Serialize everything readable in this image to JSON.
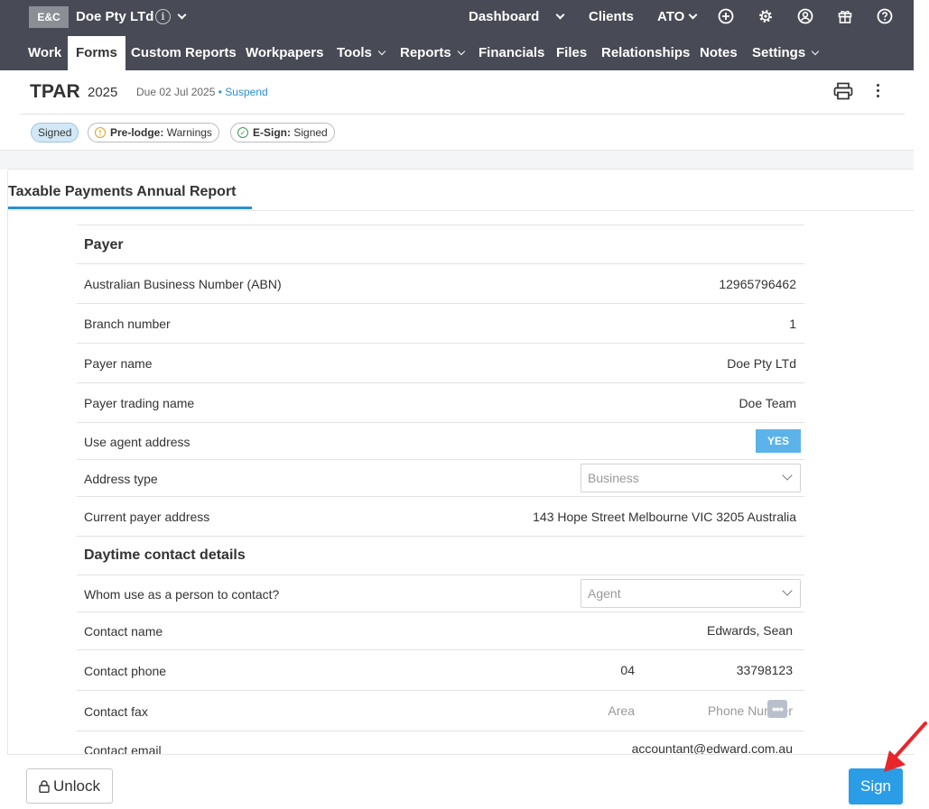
{
  "topbar": {
    "logo": "E&C",
    "client_name": "Doe Pty LTd",
    "nav": [
      "Dashboard",
      "Clients",
      "ATO"
    ]
  },
  "menu": {
    "items": [
      {
        "label": "Work"
      },
      {
        "label": "Forms"
      },
      {
        "label": "Custom Reports"
      },
      {
        "label": "Workpapers"
      },
      {
        "label": "Tools"
      },
      {
        "label": "Reports"
      },
      {
        "label": "Financials"
      },
      {
        "label": "Files"
      },
      {
        "label": "Relationships"
      },
      {
        "label": "Notes"
      },
      {
        "label": "Settings"
      }
    ]
  },
  "header": {
    "title": "TPAR",
    "year": "2025",
    "due": "Due 02 Jul 2025",
    "separator": "•",
    "suspend": "Suspend"
  },
  "badges": {
    "signed": "Signed",
    "prelodge_label": "Pre-lodge:",
    "prelodge_value": "Warnings",
    "esign_label": "E-Sign:",
    "esign_value": "Signed"
  },
  "tab": {
    "label": "Taxable Payments Annual Report"
  },
  "form": {
    "payer_section": "Payer",
    "abn_label": "Australian Business Number (ABN)",
    "abn_value": "12965796462",
    "branch_label": "Branch number",
    "branch_value": "1",
    "payer_name_label": "Payer name",
    "payer_name_value": "Doe Pty LTd",
    "trading_label": "Payer trading name",
    "trading_value": "Doe Team",
    "agent_addr_label": "Use agent address",
    "agent_addr_value": "YES",
    "addr_type_label": "Address type",
    "addr_type_value": "Business",
    "current_addr_label": "Current payer address",
    "current_addr_value": "143 Hope Street Melbourne VIC 3205 Australia",
    "contact_section": "Daytime contact details",
    "whom_label": "Whom use as a person to contact?",
    "whom_value": "Agent",
    "contact_name_label": "Contact name",
    "contact_name_value": "Edwards, Sean",
    "phone_label": "Contact phone",
    "phone_area": "04",
    "phone_number": "33798123",
    "fax_label": "Contact fax",
    "fax_area_placeholder": "Area",
    "fax_number_placeholder": "Phone Number",
    "email_label": "Contact email",
    "email_value": "accountant@edward.com.au"
  },
  "footer": {
    "unlock": "Unlock",
    "sign": "Sign"
  },
  "colors": {
    "topbar": "#484a55",
    "accent": "#2a9de6",
    "yes": "#5cb3ea",
    "arrow": "#e8262b"
  }
}
